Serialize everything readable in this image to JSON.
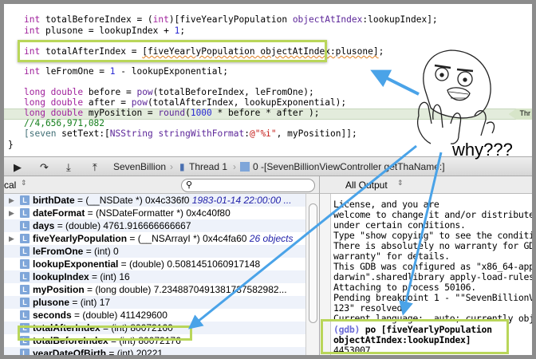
{
  "editor": {
    "lines": [
      [
        [
          "int",
          "kw"
        ],
        [
          " totalBeforeIndex = (",
          ""
        ],
        [
          "int",
          "kw"
        ],
        [
          ")[fiveYearlyPopulation ",
          ""
        ],
        [
          "objectAtIndex",
          "cls"
        ],
        [
          ":lookupIndex];",
          ""
        ]
      ],
      [
        [
          "int",
          "kw"
        ],
        [
          " plusone = lookupIndex + ",
          ""
        ],
        [
          "1",
          "num"
        ],
        [
          ";",
          ""
        ]
      ],
      [
        [
          "int",
          "kw"
        ],
        [
          " totalAfterIndex = ",
          ""
        ],
        [
          "[fiveYearlyPopulation objectAtIndex:plusone]",
          "squig"
        ],
        [
          ";",
          ""
        ]
      ],
      [
        [
          "int",
          "kw"
        ],
        [
          " leFromOne = ",
          ""
        ],
        [
          "1",
          "num"
        ],
        [
          " - lookupExponential;",
          ""
        ]
      ],
      [
        [
          "long double",
          "kw"
        ],
        [
          " before = ",
          ""
        ],
        [
          "pow",
          "cls"
        ],
        [
          "(totalBeforeIndex, leFromOne);",
          ""
        ]
      ],
      [
        [
          "long double",
          "kw"
        ],
        [
          " after = ",
          ""
        ],
        [
          "pow",
          "cls"
        ],
        [
          "(totalAfterIndex, lookupExponential);",
          ""
        ]
      ],
      [
        [
          "long double",
          "kw"
        ],
        [
          " myPosition = ",
          ""
        ],
        [
          "round",
          "cls"
        ],
        [
          "(",
          ""
        ],
        [
          "1000",
          "num"
        ],
        [
          " * before * after );",
          ""
        ]
      ],
      [
        [
          "//4,656,971,082",
          "cm"
        ]
      ],
      [
        [
          "[",
          "fn"
        ],
        [
          "seven",
          "fn"
        ],
        [
          " setText:[",
          ""
        ],
        [
          "NSString",
          "cls"
        ],
        [
          " ",
          ""
        ],
        [
          "stringWithFormat",
          "cls"
        ],
        [
          ":",
          ""
        ],
        [
          "@\"%i\"",
          "str"
        ],
        [
          ", myPosition]];",
          ""
        ]
      ],
      [
        [
          "}",
          ""
        ]
      ]
    ],
    "thread_tag": "Thr"
  },
  "annotation": {
    "why_text": "why???",
    "arrow_color": "#4aa3e8",
    "highlight_color": "#b9d65a"
  },
  "debug_bar": {
    "project": "SevenBillion",
    "thread": "Thread 1",
    "frame": "0 -[SevenBillionViewController getThaName:]"
  },
  "variables": {
    "scope": "cal",
    "search_placeholder": "",
    "rows": [
      {
        "name": "birthDate",
        "value": " = (__NSDate *) 0x4c336f0 ",
        "summary": "1983-01-14 22:00:00 ...",
        "expand": true
      },
      {
        "name": "dateFormat",
        "value": " = (NSDateFormatter *) 0x4c40f80",
        "summary": "",
        "expand": true
      },
      {
        "name": "days",
        "value": " = (double) 4761.916666666667",
        "summary": "",
        "expand": false
      },
      {
        "name": "fiveYearlyPopulation",
        "value": " = (__NSArrayI *) 0x4c4fa60 ",
        "summary": "26 objects",
        "expand": true
      },
      {
        "name": "leFromOne",
        "value": " = (int) 0",
        "summary": "",
        "expand": false
      },
      {
        "name": "lookupExponential",
        "value": " = (double) 0.5081451060917148",
        "summary": "",
        "expand": false
      },
      {
        "name": "lookupIndex",
        "value": " = (int) 16",
        "summary": "",
        "expand": false
      },
      {
        "name": "myPosition",
        "value": " = (long double) 7.2348870491381737582982...",
        "summary": "",
        "expand": false
      },
      {
        "name": "plusone",
        "value": " = (int) 17",
        "summary": "",
        "expand": false
      },
      {
        "name": "seconds",
        "value": " = (double) 411429600",
        "summary": "",
        "expand": false
      },
      {
        "name": "totalAfterIndex",
        "value": " = (int) 80072160",
        "summary": "",
        "expand": false
      },
      {
        "name": "totalBeforeIndex",
        "value": " = (int) 80072176",
        "summary": "",
        "expand": false
      },
      {
        "name": "yearDateOfBirth",
        "value": " = (int) 20221",
        "summary": "",
        "expand": false
      }
    ]
  },
  "output": {
    "filter": "All Output",
    "lines": [
      "License, and you are",
      "welcome to change it and/or distribute",
      "under certain conditions.",
      "Type \"show copying\" to see the conditi",
      "There is absolutely no warranty for GD",
      "warranty\" for details.",
      "This GDB was configured as \"x86_64-app",
      "darwin\".sharedlibrary apply-load-rules",
      "Attaching to process 50106.",
      "Pending breakpoint 1 - \"\"SevenBillionV",
      "123\" resolved",
      "Current language:  auto; currently obj"
    ],
    "prompt": "(gdb)",
    "command1": " po [fiveYearlyPopulation",
    "command2": "objectAtIndex:lookupIndex]",
    "result": "4453007"
  }
}
